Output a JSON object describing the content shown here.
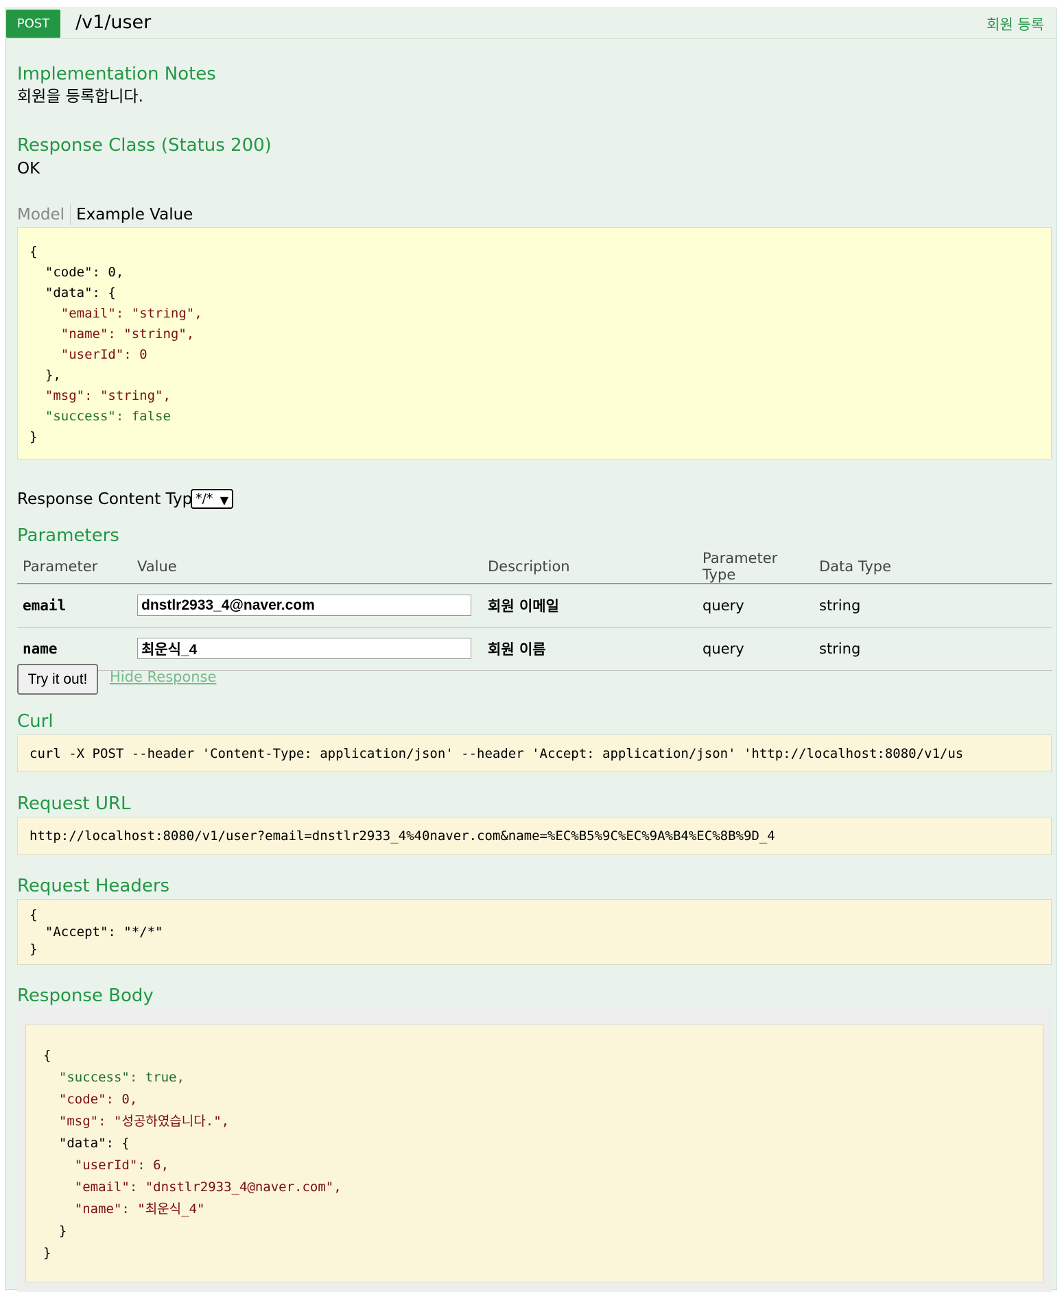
{
  "operation": {
    "method": "POST",
    "path": "/v1/user",
    "summary": "회원 등록"
  },
  "notes": {
    "heading": "Implementation Notes",
    "text": "회원을 등록합니다."
  },
  "response_class": {
    "heading": "Response Class (Status 200)",
    "status_text": "OK",
    "tabs": {
      "model": "Model",
      "example": "Example Value"
    },
    "example_lines": [
      "{",
      "  \"code\": 0,",
      "  \"data\": {",
      "    \"email\": \"string\",",
      "    \"name\": \"string\",",
      "    \"userId\": 0",
      "  },",
      "  \"msg\": \"string\",",
      "  \"success\": false",
      "}"
    ]
  },
  "content_type": {
    "label": "Response Content Type",
    "selected": "*/*"
  },
  "parameters": {
    "heading": "Parameters",
    "columns": [
      "Parameter",
      "Value",
      "Description",
      "Parameter Type",
      "Data Type"
    ],
    "rows": [
      {
        "name": "email",
        "value": "dnstlr2933_4@naver.com",
        "description": "회원 이메일",
        "param_type": "query",
        "data_type": "string"
      },
      {
        "name": "name",
        "value": "최운식_4",
        "description": "회원 이름",
        "param_type": "query",
        "data_type": "string"
      }
    ]
  },
  "actions": {
    "try_label": "Try it out!",
    "hide_label": "Hide Response"
  },
  "curl": {
    "heading": "Curl",
    "command": "curl -X POST --header 'Content-Type: application/json' --header 'Accept: application/json' 'http://localhost:8080/v1/us"
  },
  "request_url": {
    "heading": "Request URL",
    "url": "http://localhost:8080/v1/user?email=dnstlr2933_4%40naver.com&name=%EC%B5%9C%EC%9A%B4%EC%8B%9D_4"
  },
  "request_headers": {
    "heading": "Request Headers",
    "lines": [
      "{",
      "  \"Accept\": \"*/*\"",
      "}"
    ]
  },
  "response_body": {
    "heading": "Response Body",
    "lines": [
      "{",
      "  \"success\": true,",
      "  \"code\": 0,",
      "  \"msg\": \"성공하였습니다.\",",
      "  \"data\": {",
      "    \"userId\": 6,",
      "    \"email\": \"dnstlr2933_4@naver.com\",",
      "    \"name\": \"최운식_4\"",
      "  }",
      "}"
    ]
  },
  "colors": {
    "method_bg": "#249744",
    "heading": "#249744",
    "panel_bg": "#e9f3ec",
    "example_bg": "#ffffd6",
    "code_bg": "#fbf5da"
  }
}
